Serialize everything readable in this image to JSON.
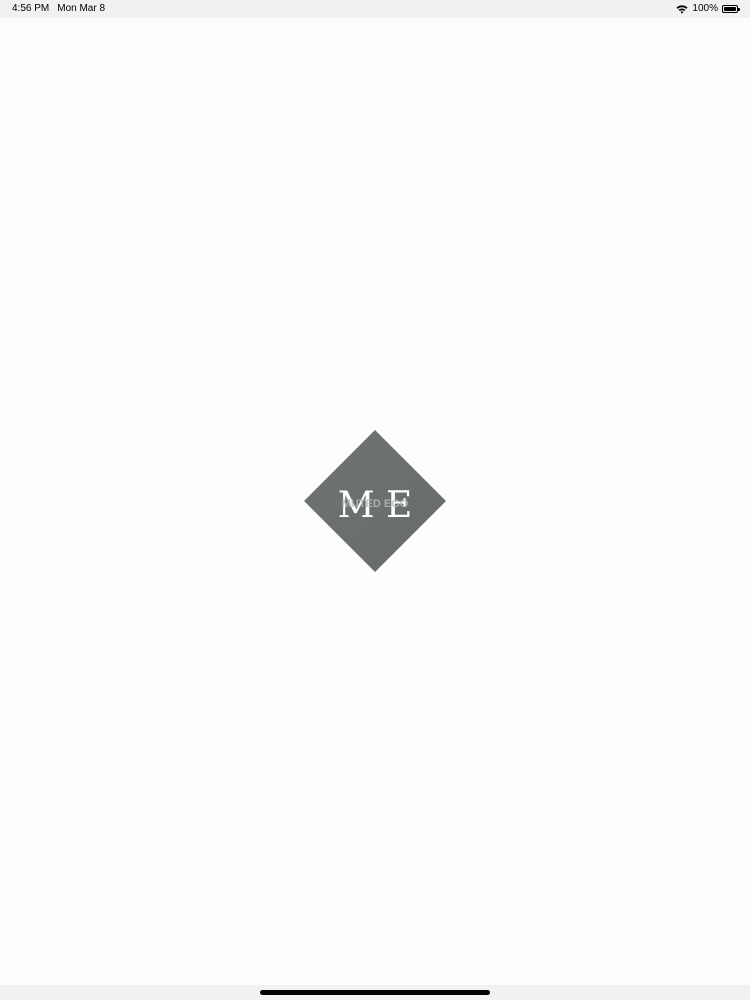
{
  "status_bar": {
    "time": "4:56 PM",
    "date": "Mon Mar 8",
    "battery_text": "100%",
    "battery_level": 1.0,
    "icons": [
      "wifi-icon",
      "battery-icon"
    ]
  },
  "logo": {
    "letters": "M E",
    "overlay_text": "MUTED EGO",
    "diamond_color": "#676c68",
    "letter_color": "#ffffff"
  },
  "colors": {
    "background": "#fdfdfd",
    "status_bar": "#f0f1f2"
  }
}
